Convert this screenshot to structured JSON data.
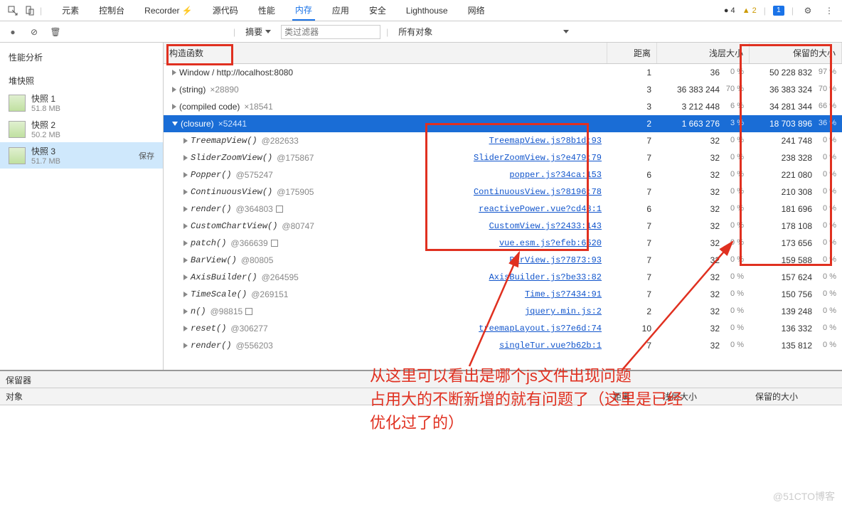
{
  "toolbar": {
    "tabs": [
      "元素",
      "控制台",
      "Recorder ⚡",
      "源代码",
      "性能",
      "内存",
      "应用",
      "安全",
      "Lighthouse",
      "网络"
    ],
    "active_tab": 5,
    "errors": "● 4",
    "warnings": "▲ 2",
    "messages": "1"
  },
  "filter": {
    "summary": "摘要",
    "class_filter_placeholder": "类过滤器",
    "all_objects": "所有对象"
  },
  "sidebar": {
    "title": "性能分析",
    "section": "堆快照",
    "snapshots": [
      {
        "name": "快照 1",
        "size": "51.8 MB"
      },
      {
        "name": "快照 2",
        "size": "50.2 MB"
      },
      {
        "name": "快照 3",
        "size": "51.7 MB",
        "save": "保存"
      }
    ]
  },
  "table": {
    "headers": {
      "constructor": "构造函数",
      "distance": "距离",
      "shallow": "浅层大小",
      "retained": "保留的大小"
    },
    "rows": [
      {
        "level": 0,
        "expanded": false,
        "name": "Window / http://localhost:8080",
        "gray": "",
        "link": "",
        "dist": "1",
        "shallow": "36",
        "shallow_pct": "0 %",
        "retained": "50 228 832",
        "retained_pct": "97 %"
      },
      {
        "level": 0,
        "expanded": false,
        "name": "(string)",
        "gray": "×28890",
        "link": "",
        "dist": "3",
        "shallow": "36 383 244",
        "shallow_pct": "70 %",
        "retained": "36 383 324",
        "retained_pct": "70 %"
      },
      {
        "level": 0,
        "expanded": false,
        "name": "(compiled code)",
        "gray": "×18541",
        "link": "",
        "dist": "3",
        "shallow": "3 212 448",
        "shallow_pct": "6 %",
        "retained": "34 281 344",
        "retained_pct": "66 %"
      },
      {
        "level": 0,
        "expanded": true,
        "selected": true,
        "name": "(closure)",
        "gray": "×52441",
        "link": "",
        "dist": "2",
        "shallow": "1 663 276",
        "shallow_pct": "3 %",
        "retained": "18 703 896",
        "retained_pct": "36 %"
      },
      {
        "level": 1,
        "expanded": false,
        "italic": true,
        "name": "TreemapView()",
        "gray": "@282633",
        "link": "TreemapView.js?8b1d:93",
        "dist": "7",
        "shallow": "32",
        "shallow_pct": "0 %",
        "retained": "241 748",
        "retained_pct": "0 %"
      },
      {
        "level": 1,
        "expanded": false,
        "italic": true,
        "name": "SliderZoomView()",
        "gray": "@175867",
        "link": "SliderZoomView.js?e479:79",
        "dist": "7",
        "shallow": "32",
        "shallow_pct": "0 %",
        "retained": "238 328",
        "retained_pct": "0 %"
      },
      {
        "level": 1,
        "expanded": false,
        "italic": true,
        "name": "Popper()",
        "gray": "@575247",
        "link": "popper.js?34ca:153",
        "dist": "6",
        "shallow": "32",
        "shallow_pct": "0 %",
        "retained": "221 080",
        "retained_pct": "0 %"
      },
      {
        "level": 1,
        "expanded": false,
        "italic": true,
        "name": "ContinuousView()",
        "gray": "@175905",
        "link": "ContinuousView.js?8196:78",
        "dist": "7",
        "shallow": "32",
        "shallow_pct": "0 %",
        "retained": "210 308",
        "retained_pct": "0 %"
      },
      {
        "level": 1,
        "expanded": false,
        "italic": true,
        "name": "render()",
        "gray": "@364803",
        "sq": true,
        "link": "reactivePower.vue?cd48:1",
        "dist": "6",
        "shallow": "32",
        "shallow_pct": "0 %",
        "retained": "181 696",
        "retained_pct": "0 %"
      },
      {
        "level": 1,
        "expanded": false,
        "italic": true,
        "name": "CustomChartView()",
        "gray": "@80747",
        "link": "CustomView.js?2433:143",
        "dist": "7",
        "shallow": "32",
        "shallow_pct": "0 %",
        "retained": "178 108",
        "retained_pct": "0 %"
      },
      {
        "level": 1,
        "expanded": false,
        "italic": true,
        "name": "patch()",
        "gray": "@366639",
        "sq": true,
        "link": "vue.esm.js?efeb:6520",
        "dist": "7",
        "shallow": "32",
        "shallow_pct": "0 %",
        "retained": "173 656",
        "retained_pct": "0 %"
      },
      {
        "level": 1,
        "expanded": false,
        "italic": true,
        "name": "BarView()",
        "gray": "@80805",
        "link": "BarView.js?7873:93",
        "dist": "7",
        "shallow": "32",
        "shallow_pct": "0 %",
        "retained": "159 588",
        "retained_pct": "0 %"
      },
      {
        "level": 1,
        "expanded": false,
        "italic": true,
        "name": "AxisBuilder()",
        "gray": "@264595",
        "link": "AxisBuilder.js?be33:82",
        "dist": "7",
        "shallow": "32",
        "shallow_pct": "0 %",
        "retained": "157 624",
        "retained_pct": "0 %"
      },
      {
        "level": 1,
        "expanded": false,
        "italic": true,
        "name": "TimeScale()",
        "gray": "@269151",
        "link": "Time.js?7434:91",
        "dist": "7",
        "shallow": "32",
        "shallow_pct": "0 %",
        "retained": "150 756",
        "retained_pct": "0 %"
      },
      {
        "level": 1,
        "expanded": false,
        "italic": true,
        "name": "n()",
        "gray": "@98815",
        "sq": true,
        "link": "jquery.min.js:2",
        "dist": "2",
        "shallow": "32",
        "shallow_pct": "0 %",
        "retained": "139 248",
        "retained_pct": "0 %"
      },
      {
        "level": 1,
        "expanded": false,
        "italic": true,
        "name": "reset()",
        "gray": "@306277",
        "link": "treemapLayout.js?7e6d:74",
        "dist": "10",
        "shallow": "32",
        "shallow_pct": "0 %",
        "retained": "136 332",
        "retained_pct": "0 %"
      },
      {
        "level": 1,
        "expanded": false,
        "italic": true,
        "name": "render()",
        "gray": "@556203",
        "link": "singleTur.vue?b62b:1",
        "dist": "7",
        "shallow": "32",
        "shallow_pct": "0 %",
        "retained": "135 812",
        "retained_pct": "0 %"
      }
    ]
  },
  "retainers": {
    "title": "保留器",
    "object": "对象",
    "distance": "距离",
    "shallow": "浅层大小",
    "retained": "保留的大小"
  },
  "annotation": {
    "line1": "从这里可以看出是哪个js文件出现问题",
    "line2": "占用大的不断新增的就有问题了（这里是已经",
    "line3": "优化过了的）"
  },
  "watermark": "@51CTO博客"
}
